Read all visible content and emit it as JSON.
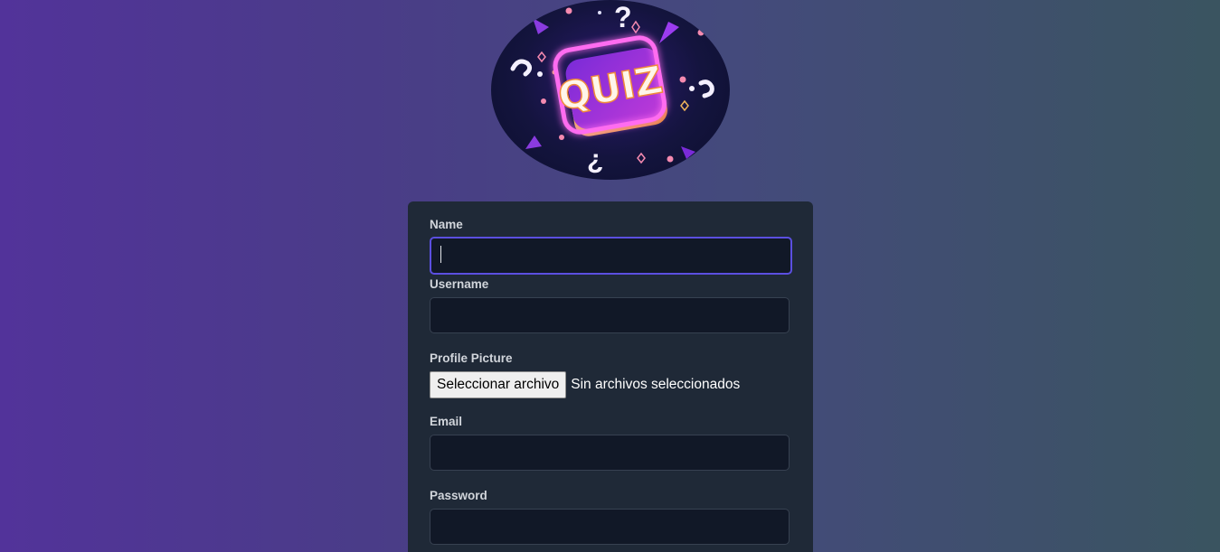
{
  "logo": {
    "text": "QUIZ",
    "colors": {
      "background": "#0b0f2c",
      "neon": "#e05cff",
      "accent": "#f5a623"
    }
  },
  "form": {
    "name": {
      "label": "Name",
      "value": "",
      "focused": true
    },
    "username": {
      "label": "Username",
      "value": ""
    },
    "profile_picture": {
      "label": "Profile Picture",
      "button_label": "Seleccionar archivo",
      "status": "Sin archivos seleccionados"
    },
    "email": {
      "label": "Email",
      "value": ""
    },
    "password": {
      "label": "Password",
      "value": ""
    }
  },
  "colors": {
    "card": "#1f2937",
    "input": "#111827",
    "focus_border": "#5b4fe0",
    "label": "#d1d5db"
  }
}
